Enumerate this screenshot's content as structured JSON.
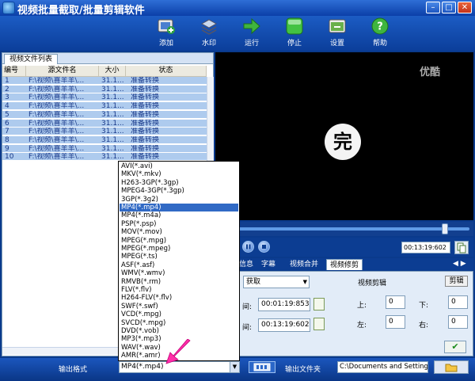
{
  "app": {
    "title": "视频批量截取/批量剪辑软件"
  },
  "toolbar": {
    "add": "添加",
    "watermark": "水印",
    "run": "运行",
    "stop": "停止",
    "settings": "设置",
    "help": "帮助"
  },
  "list_panel": {
    "tab_label": "视频文件列表",
    "columns": [
      "编号",
      "源文件名",
      "大小",
      "状态"
    ],
    "rows": [
      {
        "no": "1",
        "name": "F:\\视频\\喜羊羊\\...",
        "size": "31.1...",
        "status": "准备转换"
      },
      {
        "no": "2",
        "name": "F:\\视频\\喜羊羊\\...",
        "size": "31.1...",
        "status": "准备转换"
      },
      {
        "no": "3",
        "name": "F:\\视频\\喜羊羊\\...",
        "size": "31.1...",
        "status": "准备转换"
      },
      {
        "no": "4",
        "name": "F:\\视频\\喜羊羊\\...",
        "size": "31.1...",
        "status": "准备转换"
      },
      {
        "no": "5",
        "name": "F:\\视频\\喜羊羊\\...",
        "size": "31.1...",
        "status": "准备转换"
      },
      {
        "no": "6",
        "name": "F:\\视频\\喜羊羊\\...",
        "size": "31.1...",
        "status": "准备转换"
      },
      {
        "no": "7",
        "name": "F:\\视频\\喜羊羊\\...",
        "size": "31.1...",
        "status": "准备转换"
      },
      {
        "no": "8",
        "name": "F:\\视频\\喜羊羊\\...",
        "size": "31.1...",
        "status": "准备转换"
      },
      {
        "no": "9",
        "name": "F:\\视频\\喜羊羊\\...",
        "size": "31.1...",
        "status": "准备转换"
      },
      {
        "no": "10",
        "name": "F:\\视频\\喜羊羊\\...",
        "size": "31.1...",
        "status": "准备转换"
      }
    ]
  },
  "video": {
    "watermark": "优酷",
    "overlay_char": "完"
  },
  "player": {
    "current_time": "00:13:19:602",
    "seek_fraction": 0.9
  },
  "tabs": [
    "信息",
    "字幕",
    "视频合并",
    "视频修剪"
  ],
  "active_tab": "视频修剪",
  "tab_arrows": "◀ ▶",
  "edit": {
    "mode_value": "获取",
    "start_label": "间:",
    "start_value": "00:01:19:853",
    "end_label": "间:",
    "end_value": "00:13:19:602",
    "crop_title": "视频剪辑",
    "crop_button": "剪辑",
    "top_label": "上:",
    "top_value": "0",
    "bottom_label": "下:",
    "bottom_value": "0",
    "left_label": "左:",
    "left_value": "0",
    "right_label": "右:",
    "right_value": "0",
    "ok_symbol": "✔"
  },
  "bottom": {
    "output_format_label": "输出格式",
    "output_format_value": "MP4(*.mp4)",
    "output_folder_label": "输出文件夹",
    "output_folder_value": "C:\\Documents and Setting"
  },
  "format_options": [
    "AVI(*.avi)",
    "MKV(*.mkv)",
    "H263-3GP(*.3gp)",
    "MPEG4-3GP(*.3gp)",
    "3GP(*.3g2)",
    "MP4(*.mp4)",
    "MP4(*.m4a)",
    "PSP(*.psp)",
    "MOV(*.mov)",
    "MPEG(*.mpg)",
    "MPEG(*.mpeg)",
    "MPEG(*.ts)",
    "ASF(*.asf)",
    "WMV(*.wmv)",
    "RMVB(*.rm)",
    "FLV(*.flv)",
    "H264-FLV(*.flv)",
    "SWF(*.swf)",
    "VCD(*.mpg)",
    "SVCD(*.mpg)",
    "DVD(*.vob)",
    "MP3(*.mp3)",
    "WAV(*.wav)",
    "AMR(*.amr)"
  ],
  "selected_format_index": 5,
  "colors": {
    "selection": "#316ac5",
    "row_bg": "#aecbee",
    "titlebar": "#0b3fa8"
  }
}
